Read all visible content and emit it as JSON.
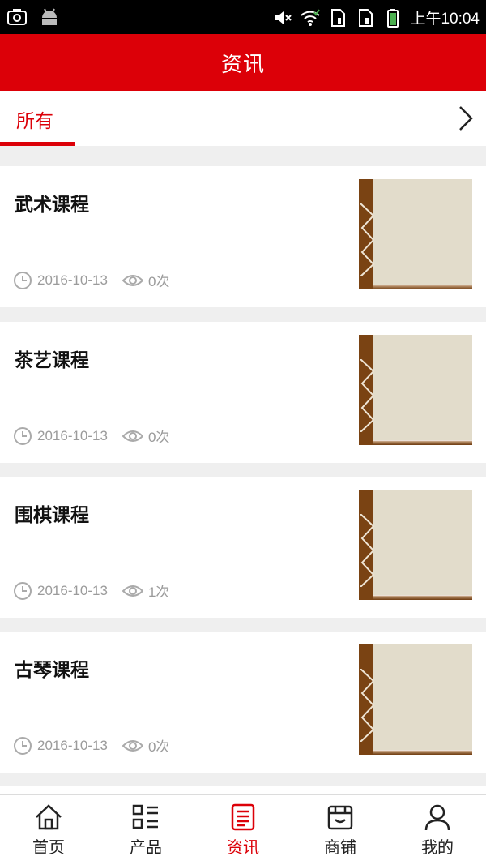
{
  "status_bar": {
    "time": "上午10:04",
    "icons": [
      "screenshot-icon",
      "android-icon",
      "mute-icon",
      "wifi-icon",
      "sim1-icon",
      "sim2-icon",
      "battery-icon"
    ]
  },
  "header": {
    "title": "资讯"
  },
  "tabs": {
    "active_label": "所有",
    "more_icon": "chevron-right-icon"
  },
  "colors": {
    "brand": "#dc0008",
    "meta_gray": "#9b9b9b",
    "page_bg": "#efefef"
  },
  "news": [
    {
      "title": "武术课程",
      "date": "2016-10-13",
      "views": "0次"
    },
    {
      "title": "茶艺课程",
      "date": "2016-10-13",
      "views": "0次"
    },
    {
      "title": "围棋课程",
      "date": "2016-10-13",
      "views": "1次"
    },
    {
      "title": "古琴课程",
      "date": "2016-10-13",
      "views": "0次"
    }
  ],
  "bottom_nav": [
    {
      "label": "首页",
      "icon": "home-icon"
    },
    {
      "label": "产品",
      "icon": "grid-list-icon"
    },
    {
      "label": "资讯",
      "icon": "news-icon",
      "active": true
    },
    {
      "label": "商铺",
      "icon": "shop-icon"
    },
    {
      "label": "我的",
      "icon": "user-icon"
    }
  ]
}
